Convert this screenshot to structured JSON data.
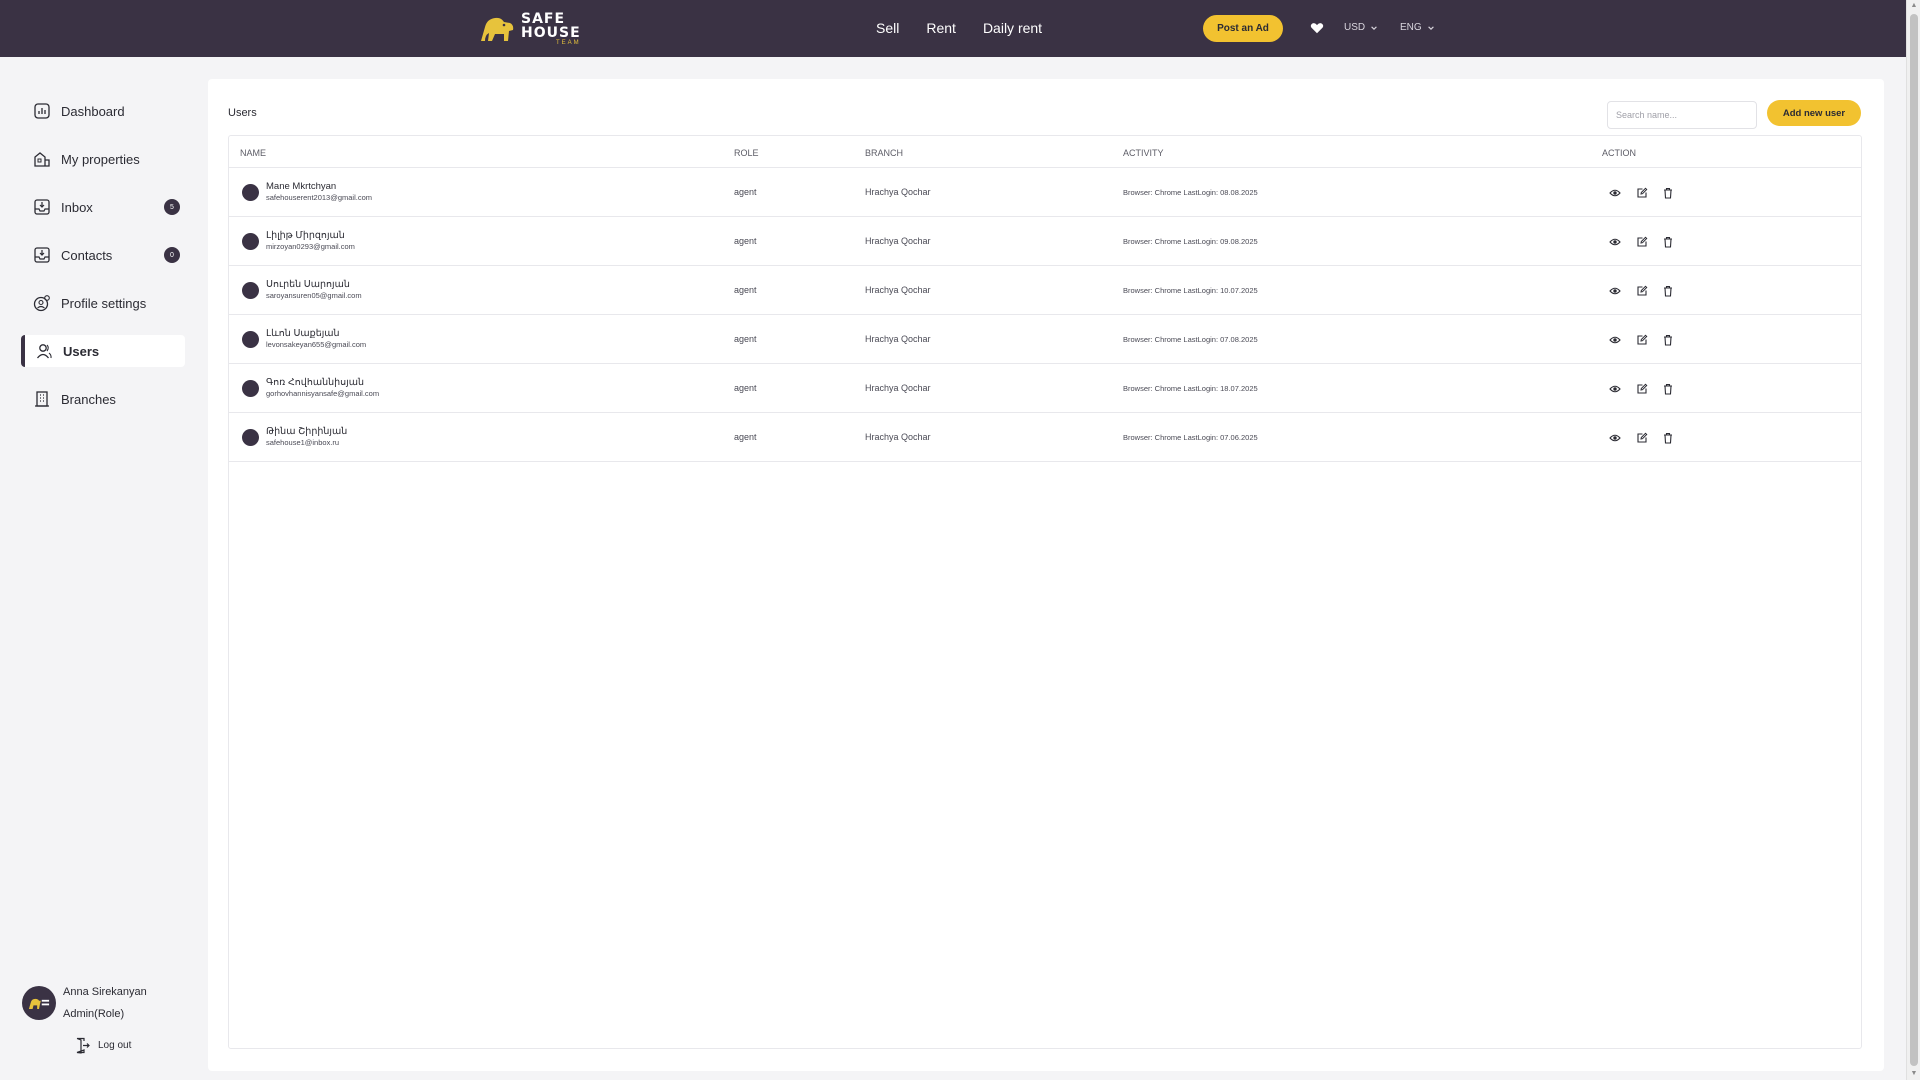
{
  "topbar": {
    "logo": {
      "line1": "SAFE",
      "line2": "HOUSE",
      "line3": "TEAM"
    },
    "nav": [
      "Sell",
      "Rent",
      "Daily rent"
    ],
    "post_ad_label": "Post an Ad",
    "currency": "USD",
    "language": "ENG"
  },
  "sidebar": {
    "items": [
      {
        "label": "Dashboard",
        "icon": "dashboard-icon"
      },
      {
        "label": "My properties",
        "icon": "properties-icon"
      },
      {
        "label": "Inbox",
        "icon": "inbox-icon",
        "badge": "5"
      },
      {
        "label": "Contacts",
        "icon": "contacts-icon",
        "badge": "0"
      },
      {
        "label": "Profile settings",
        "icon": "profile-settings-icon"
      },
      {
        "label": "Users",
        "icon": "users-icon",
        "active": true
      },
      {
        "label": "Branches",
        "icon": "branches-icon"
      }
    ],
    "profile": {
      "name": "Anna Sirekanyan",
      "role": "Admin(Role)"
    },
    "logout_label": "Log out"
  },
  "main": {
    "title": "Users",
    "search": {
      "placeholder": "Search name..."
    },
    "add_user_label": "Add new user",
    "columns": [
      "Name",
      "Role",
      "Branch",
      "Activity",
      "Action"
    ],
    "rows": [
      {
        "name": "Mane Mkrtchyan",
        "email": "safehouserent2013@gmail.com",
        "role": "agent",
        "branch": "Hrachya Qochar",
        "activity": "Browser: Chrome LastLogin: 08.08.2025"
      },
      {
        "name": "Լիլիթ Միրզոյան",
        "email": "mirzoyan0293@gmail.com",
        "role": "agent",
        "branch": "Hrachya Qochar",
        "activity": "Browser: Chrome LastLogin: 09.08.2025"
      },
      {
        "name": "Սուրեն Սարոյան",
        "email": "saroyansuren05@gmail.com",
        "role": "agent",
        "branch": "Hrachya Qochar",
        "activity": "Browser: Chrome LastLogin: 10.07.2025"
      },
      {
        "name": "Լևոն Սաքեյան",
        "email": "levonsakeyan655@gmail.com",
        "role": "agent",
        "branch": "Hrachya Qochar",
        "activity": "Browser: Chrome LastLogin: 07.08.2025"
      },
      {
        "name": "Գոռ Հովհաննիսյան",
        "email": "gorhovhannisyansafe@gmail.com",
        "role": "agent",
        "branch": "Hrachya Qochar",
        "activity": "Browser: Chrome LastLogin: 18.07.2025"
      },
      {
        "name": "Թինա Շիրինյան",
        "email": "safehouse1@inbox.ru",
        "role": "agent",
        "branch": "Hrachya Qochar",
        "activity": "Browser: Chrome LastLogin: 07.06.2025"
      }
    ]
  },
  "colors": {
    "nav_bg": "#3a3244",
    "accent": "#f2c230",
    "panel_bg": "#ffffff",
    "page_bg": "#f4f4f6"
  }
}
